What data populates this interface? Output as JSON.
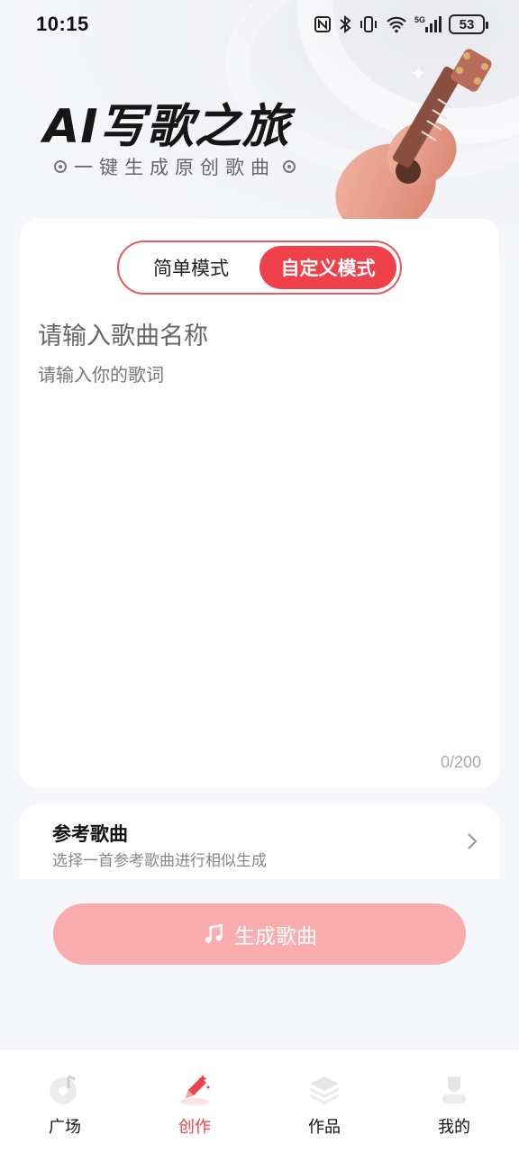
{
  "status_bar": {
    "time": "10:15",
    "icons": [
      "nfc-icon",
      "bluetooth-icon",
      "vibrate-icon",
      "wifi-icon",
      "signal-5g-icon"
    ],
    "network": "5G",
    "battery": "53"
  },
  "hero": {
    "title": "AI写歌之旅",
    "subtitle": "一键生成原创歌曲"
  },
  "mode_toggle": {
    "simple_label": "简单模式",
    "custom_label": "自定义模式",
    "active": "custom"
  },
  "editor": {
    "song_name_placeholder": "请输入歌曲名称",
    "lyrics_placeholder": "请输入你的歌词",
    "counter": "0/200"
  },
  "reference": {
    "title": "参考歌曲",
    "description": "选择一首参考歌曲进行相似生成"
  },
  "generate_button": {
    "label": "生成歌曲",
    "icon": "music-note-icon"
  },
  "bottom_nav": {
    "items": [
      {
        "label": "广场",
        "icon": "music-disc-icon"
      },
      {
        "label": "创作",
        "icon": "pen-icon"
      },
      {
        "label": "作品",
        "icon": "layers-icon"
      },
      {
        "label": "我的",
        "icon": "user-icon"
      }
    ],
    "active_index": 1
  },
  "colors": {
    "accent": "#f0414b",
    "button_disabled": "#fbacad",
    "background": "#f6f7fb"
  }
}
